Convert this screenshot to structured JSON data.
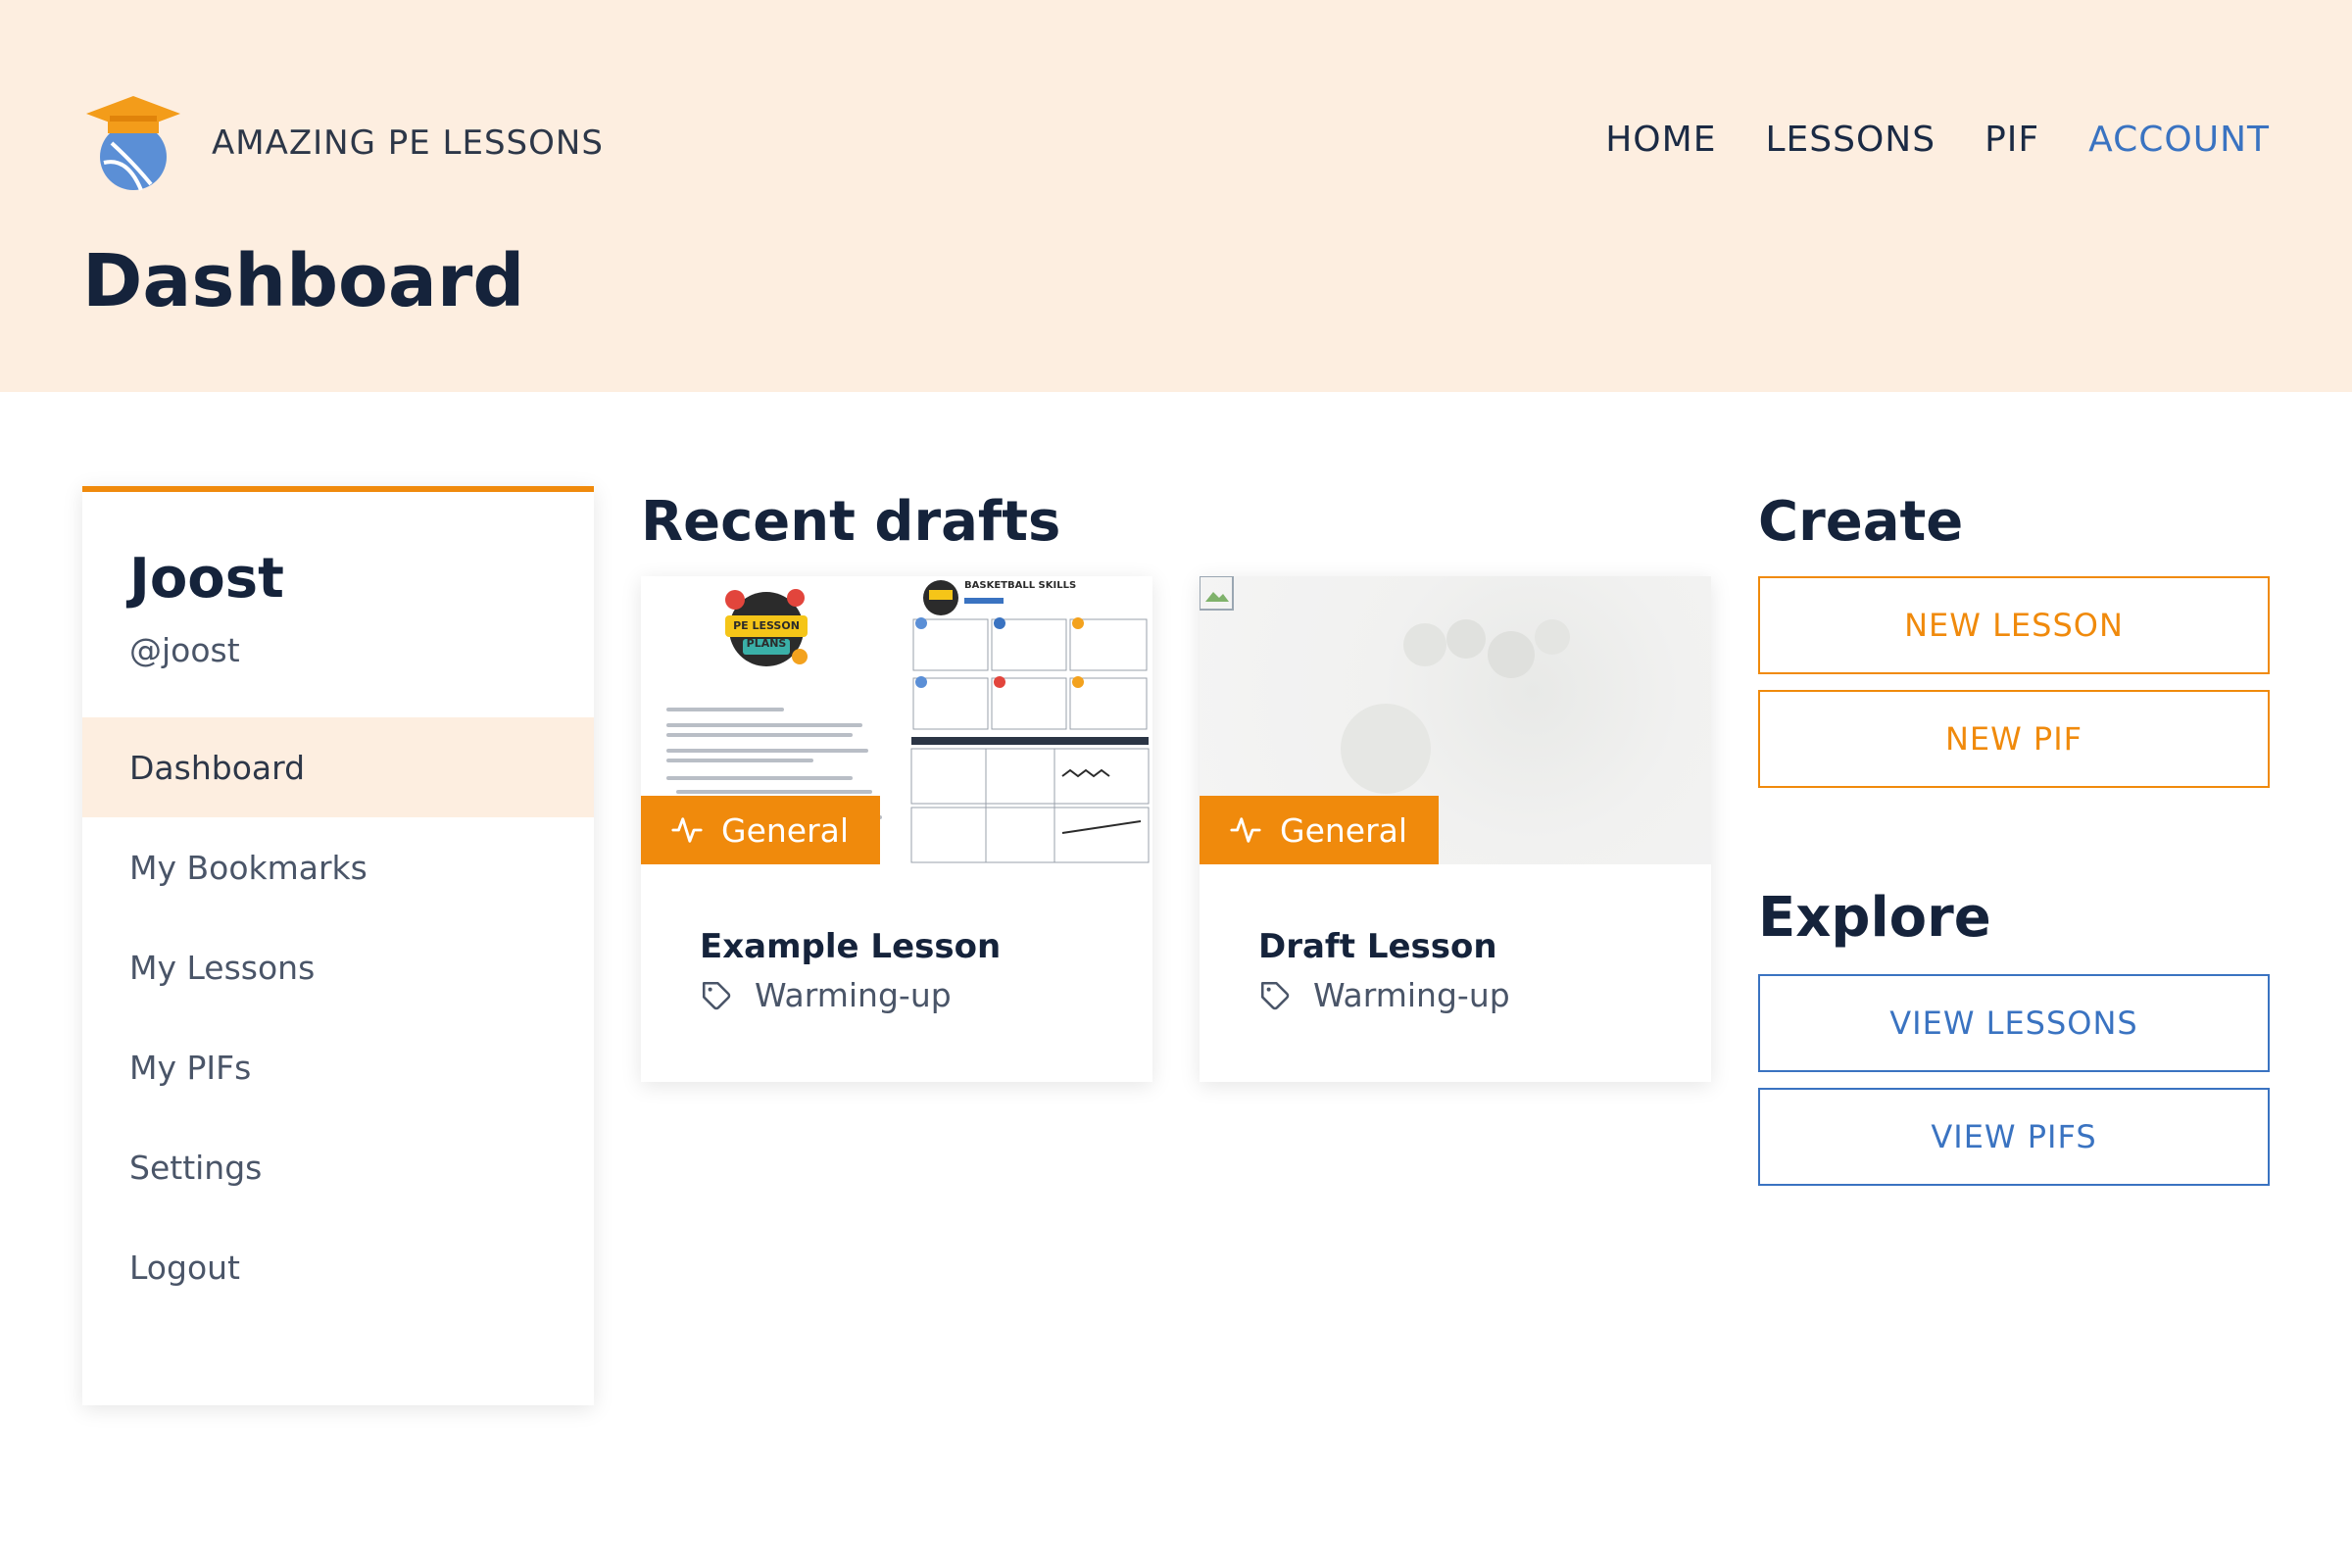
{
  "header": {
    "brand": "AMAZING PE LESSONS",
    "nav": [
      "HOME",
      "LESSONS",
      "PIF",
      "ACCOUNT"
    ],
    "active_nav": "ACCOUNT",
    "page_title": "Dashboard"
  },
  "sidebar": {
    "user_name": "Joost",
    "user_handle": "@joost",
    "items": [
      {
        "label": "Dashboard",
        "active": true
      },
      {
        "label": "My Bookmarks",
        "active": false
      },
      {
        "label": "My Lessons",
        "active": false
      },
      {
        "label": "My PIFs",
        "active": false
      },
      {
        "label": "Settings",
        "active": false
      },
      {
        "label": "Logout",
        "active": false
      }
    ]
  },
  "recent_drafts": {
    "title": "Recent drafts",
    "cards": [
      {
        "badge": "General",
        "title": "Example Lesson",
        "tag": "Warming-up",
        "thumb_logo": "PE LESSON PLANS",
        "thumb_heading": "BASKETBALL SKILLS"
      },
      {
        "badge": "General",
        "title": "Draft Lesson",
        "tag": "Warming-up"
      }
    ]
  },
  "create": {
    "title": "Create",
    "new_lesson": "NEW LESSON",
    "new_pif": "NEW PIF"
  },
  "explore": {
    "title": "Explore",
    "view_lessons": "VIEW LESSONS",
    "view_pifs": "VIEW PIFS"
  },
  "colors": {
    "accent_orange": "#f08a0c",
    "accent_blue": "#3a73c1",
    "header_bg": "#fdeee0",
    "text_dark": "#15233b"
  },
  "icons": {
    "logo": "graduation-cap-ball-icon",
    "badge": "activity-pulse-icon",
    "tag": "tag-icon"
  }
}
